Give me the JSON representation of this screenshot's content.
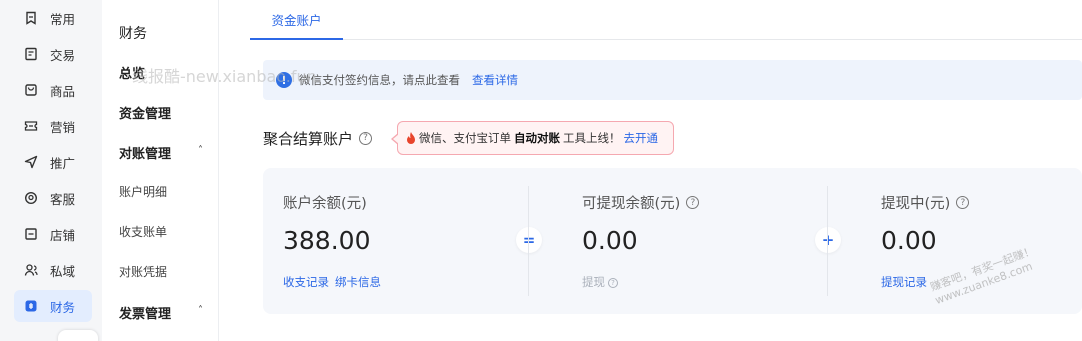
{
  "rail": {
    "items": [
      {
        "label": "常用",
        "icon": "bookmark-icon",
        "active": false
      },
      {
        "label": "交易",
        "icon": "receipt-icon",
        "active": false
      },
      {
        "label": "商品",
        "icon": "shopping-bag-icon",
        "active": false
      },
      {
        "label": "营销",
        "icon": "ticket-icon",
        "active": false
      },
      {
        "label": "推广",
        "icon": "send-icon",
        "active": false
      },
      {
        "label": "客服",
        "icon": "headset-icon",
        "active": false
      },
      {
        "label": "店铺",
        "icon": "store-icon",
        "active": false
      },
      {
        "label": "私域",
        "icon": "users-icon",
        "active": false
      },
      {
        "label": "财务",
        "icon": "finance-icon",
        "active": true
      }
    ],
    "active_color": "#2c68e6"
  },
  "sidebar": {
    "title": "财务",
    "overview": "总览",
    "fund_mgmt": "资金管理",
    "reconcile_group": "对账管理",
    "reconcile_items": [
      "账户明细",
      "收支账单",
      "对账凭据"
    ],
    "invoice_group": "发票管理",
    "caret": "˄"
  },
  "tabs": [
    {
      "label": "资金账户",
      "active": true
    }
  ],
  "notice": {
    "icon": "info-icon",
    "text": "微信支付签约信息，请点此查看",
    "link": "查看详情"
  },
  "watermark": "线报酷-new.xianbao.fun",
  "section": {
    "title": "聚合结算账户",
    "help_icon": "question-circle-icon"
  },
  "promo": {
    "icon": "fire-icon",
    "text_pre": "微信、支付宝订单",
    "text_bold": "自动对账",
    "text_post": "工具上线！",
    "link": "去开通"
  },
  "balances": [
    {
      "label": "账户余额(元)",
      "value": "388.00",
      "help": false,
      "links": [
        "收支记录",
        "绑卡信息"
      ],
      "disabled_link": ""
    },
    {
      "label": "可提现余额(元)",
      "value": "0.00",
      "help": true,
      "links": [],
      "disabled_link": "提现"
    },
    {
      "label": "提现中(元)",
      "value": "0.00",
      "help": true,
      "links": [
        "提现记录"
      ],
      "disabled_link": ""
    }
  ],
  "operators": [
    "=",
    "+"
  ],
  "corner_watermark": {
    "line1": "赚客吧，有奖一起赚！",
    "line2": "www.zuanke8.com"
  },
  "colors": {
    "accent": "#2c68e6",
    "notice_bg": "#eef3fc",
    "promo_border": "#f5a8b0",
    "card_bg": "#f5f7fb"
  }
}
